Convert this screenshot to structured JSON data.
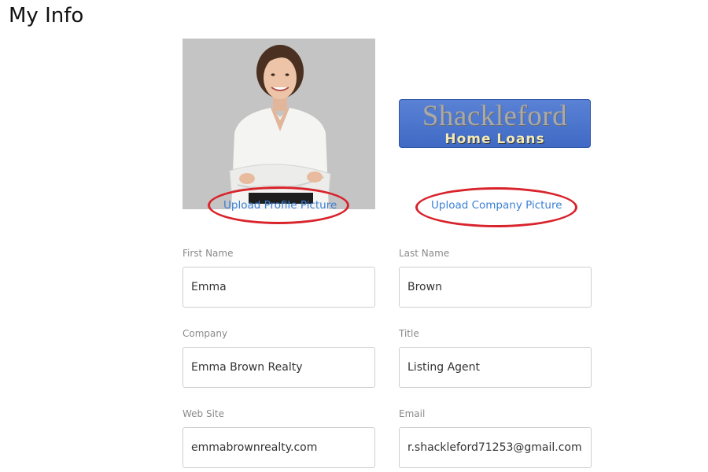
{
  "page": {
    "title": "My Info"
  },
  "profile": {
    "upload_label": "Upload Profile Picture"
  },
  "company": {
    "logo_line1": "Shackleford",
    "logo_line2": "Home Loans",
    "upload_label": "Upload Company Picture"
  },
  "form": {
    "first_name": {
      "label": "First Name",
      "value": "Emma"
    },
    "last_name": {
      "label": "Last Name",
      "value": "Brown"
    },
    "company": {
      "label": "Company",
      "value": "Emma Brown Realty"
    },
    "title": {
      "label": "Title",
      "value": "Listing Agent"
    },
    "website": {
      "label": "Web Site",
      "value": "emmabrownrealty.com"
    },
    "email": {
      "label": "Email",
      "value": "r.shackleford71253@gmail.com"
    }
  },
  "colors": {
    "link": "#3a7fd6",
    "annotation": "#d9232b",
    "logo_background": "#4a74cc"
  },
  "icons": {
    "annotations": "red-ellipse-highlight"
  }
}
